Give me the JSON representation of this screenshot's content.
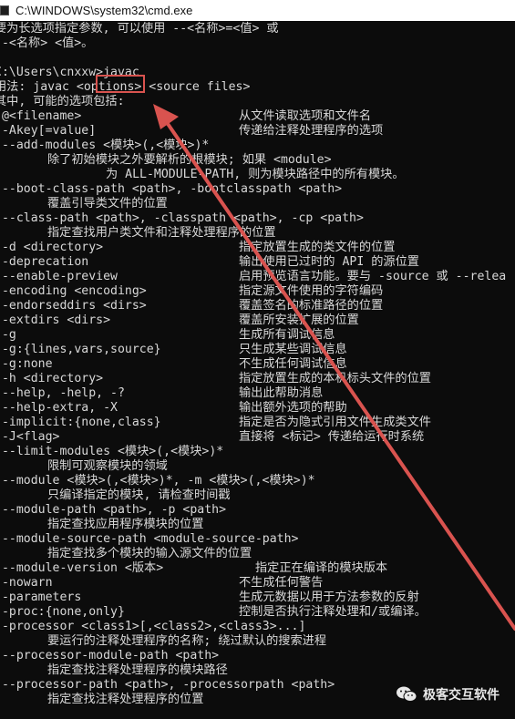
{
  "window": {
    "title": "C:\\WINDOWS\\system32\\cmd.exe"
  },
  "console": {
    "lines": [
      {
        "kind": "full",
        "text": "要为长选项指定参数, 可以使用 --<名称>=<值> 或"
      },
      {
        "kind": "full",
        "text": "--<名称> <值>。"
      },
      {
        "kind": "blank",
        "text": ""
      },
      {
        "kind": "full",
        "text": "C:\\Users\\cnxxw>javac"
      },
      {
        "kind": "full",
        "text": "用法: javac <options> <source files>"
      },
      {
        "kind": "full",
        "text": "其中, 可能的选项包括:"
      },
      {
        "kind": "pair",
        "opt": " @<filename>",
        "desc": "从文件读取选项和文件名"
      },
      {
        "kind": "pair",
        "opt": " -Akey[=value]",
        "desc": "传递给注释处理程序的选项"
      },
      {
        "kind": "full",
        "text": " --add-modules <模块>(,<模块>)*"
      },
      {
        "kind": "indent",
        "text": "除了初始模块之外要解析的根模块; 如果 <module>"
      },
      {
        "kind": "indent2",
        "text": "为 ALL-MODULE-PATH, 则为模块路径中的所有模块。"
      },
      {
        "kind": "full",
        "text": " --boot-class-path <path>, -bootclasspath <path>"
      },
      {
        "kind": "indent",
        "text": "覆盖引导类文件的位置"
      },
      {
        "kind": "full",
        "text": " --class-path <path>, -classpath <path>, -cp <path>"
      },
      {
        "kind": "indent",
        "text": "指定查找用户类文件和注释处理程序的位置"
      },
      {
        "kind": "pair",
        "opt": " -d <directory>",
        "desc": "指定放置生成的类文件的位置"
      },
      {
        "kind": "pair",
        "opt": " -deprecation",
        "desc": "输出使用已过时的 API 的源位置"
      },
      {
        "kind": "pair",
        "opt": " --enable-preview",
        "desc": "启用预览语言功能。要与 -source 或 --relea"
      },
      {
        "kind": "pair",
        "opt": " -encoding <encoding>",
        "desc": "指定源文件使用的字符编码"
      },
      {
        "kind": "pair",
        "opt": " -endorseddirs <dirs>",
        "desc": "覆盖签名的标准路径的位置"
      },
      {
        "kind": "pair",
        "opt": " -extdirs <dirs>",
        "desc": "覆盖所安装扩展的位置"
      },
      {
        "kind": "pair",
        "opt": " -g",
        "desc": "生成所有调试信息"
      },
      {
        "kind": "pair",
        "opt": " -g:{lines,vars,source}",
        "desc": "只生成某些调试信息"
      },
      {
        "kind": "pair",
        "opt": " -g:none",
        "desc": "不生成任何调试信息"
      },
      {
        "kind": "pair",
        "opt": " -h <directory>",
        "desc": "指定放置生成的本机标头文件的位置"
      },
      {
        "kind": "pair",
        "opt": " --help, -help, -?",
        "desc": "输出此帮助消息"
      },
      {
        "kind": "pair",
        "opt": " --help-extra, -X",
        "desc": "输出额外选项的帮助"
      },
      {
        "kind": "pair",
        "opt": " -implicit:{none,class}",
        "desc": "指定是否为隐式引用文件生成类文件"
      },
      {
        "kind": "pair",
        "opt": " -J<flag>",
        "desc": "直接将 <标记> 传递给运行时系统"
      },
      {
        "kind": "full",
        "text": " --limit-modules <模块>(,<模块>)*"
      },
      {
        "kind": "indent",
        "text": "限制可观察模块的领域"
      },
      {
        "kind": "full",
        "text": " --module <模块>(,<模块>)*, -m <模块>(,<模块>)*"
      },
      {
        "kind": "indent",
        "text": "只编译指定的模块, 请检查时间戳"
      },
      {
        "kind": "full",
        "text": " --module-path <path>, -p <path>"
      },
      {
        "kind": "indent",
        "text": "指定查找应用程序模块的位置"
      },
      {
        "kind": "full",
        "text": " --module-source-path <module-source-path>"
      },
      {
        "kind": "indent",
        "text": "指定查找多个模块的输入源文件的位置"
      },
      {
        "kind": "pair2",
        "opt": " --module-version <版本>",
        "desc": "指定正在编译的模块版本"
      },
      {
        "kind": "pair",
        "opt": " -nowarn",
        "desc": "不生成任何警告"
      },
      {
        "kind": "pair",
        "opt": " -parameters",
        "desc": "生成元数据以用于方法参数的反射"
      },
      {
        "kind": "pair",
        "opt": " -proc:{none,only}",
        "desc": "控制是否执行注释处理和/或编译。"
      },
      {
        "kind": "full",
        "text": " -processor <class1>[,<class2>,<class3>...]"
      },
      {
        "kind": "indent",
        "text": "要运行的注释处理程序的名称; 绕过默认的搜索进程"
      },
      {
        "kind": "full",
        "text": " --processor-module-path <path>"
      },
      {
        "kind": "indent",
        "text": "指定查找注释处理程序的模块路径"
      },
      {
        "kind": "full",
        "text": " --processor-path <path>, -processorpath <path>"
      },
      {
        "kind": "indent",
        "text": "指定查找注释处理程序的位置"
      }
    ]
  },
  "annotation": {
    "highlighted_command": "javac",
    "color": "#d9534f"
  },
  "watermark": {
    "icon": "wechat-icon",
    "text": "极客交互软件"
  }
}
